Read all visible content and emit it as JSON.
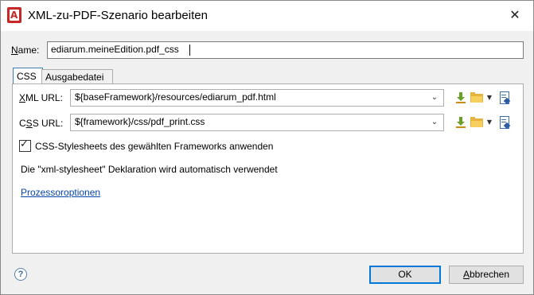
{
  "window": {
    "title": "XML-zu-PDF-Szenario bearbeiten",
    "close_glyph": "✕"
  },
  "app_icon": {
    "name": "oxygen-app-icon",
    "glyph": "A",
    "color": "#c62828"
  },
  "name_field": {
    "label": "Name:",
    "value": "ediarum.meineEdition.pdf_css"
  },
  "tabs": [
    {
      "label": "CSS",
      "active": true
    },
    {
      "label": "Ausgabedatei",
      "active": false
    }
  ],
  "xml_url": {
    "label": "XML URL:",
    "value": "${baseFramework}/resources/ediarum_pdf.html"
  },
  "css_url": {
    "label": "CSS URL:",
    "value": "${framework}/css/pdf_print.css"
  },
  "url_actions": {
    "icons": [
      "download-icon",
      "folder-icon",
      "dropdown-icon",
      "edit-file-icon"
    ]
  },
  "framework_css_checkbox": {
    "label": "CSS-Stylesheets des gewählten Frameworks anwenden",
    "checked": true
  },
  "info_text": "Die \"xml-stylesheet\" Deklaration wird automatisch verwendet",
  "processor_link": "Prozessoroptionen",
  "footer": {
    "help_glyph": "?",
    "ok_label": "OK",
    "cancel_label": "Abbrechen"
  },
  "colors": {
    "accent": "#0078d7",
    "link": "#0645ad"
  }
}
